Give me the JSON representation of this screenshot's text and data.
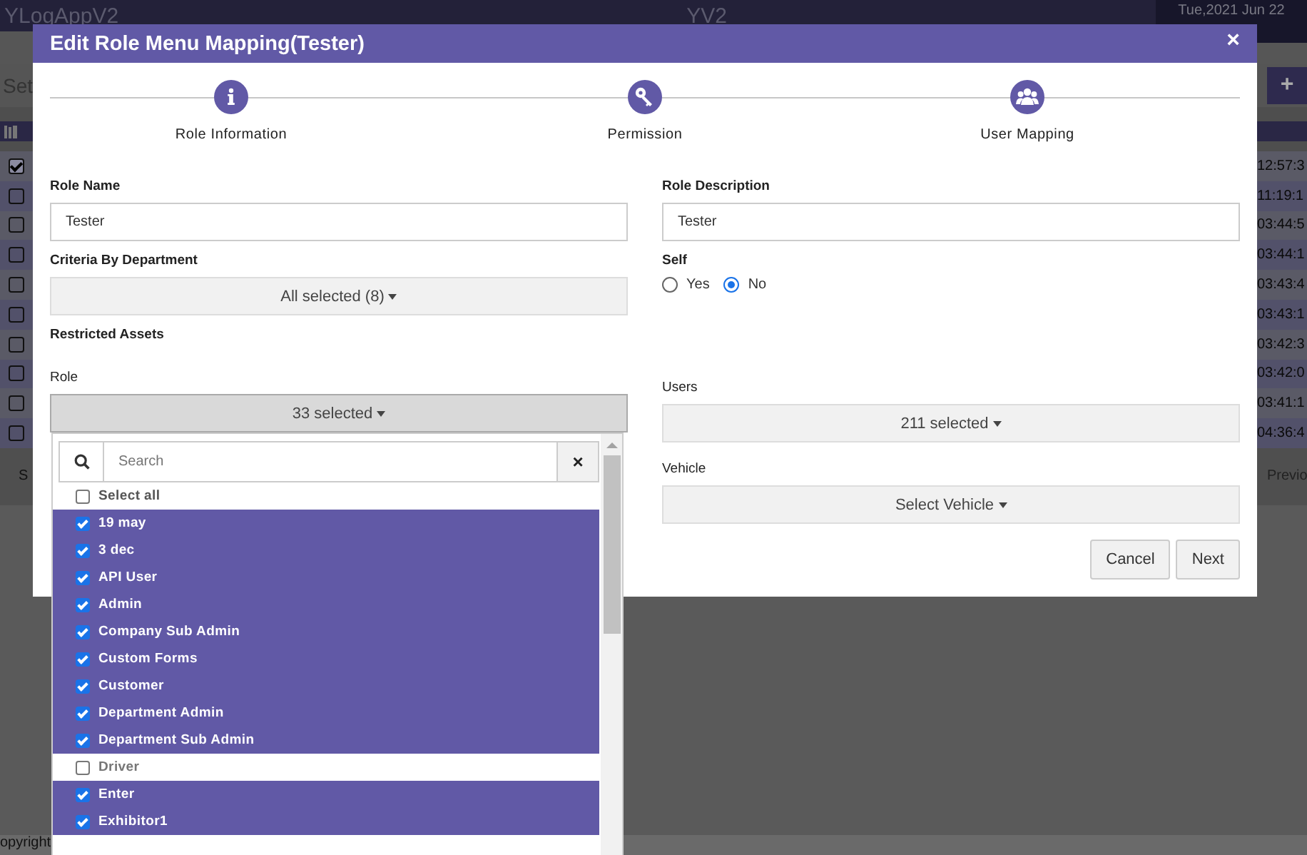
{
  "app_header": {
    "title": "YLogAppV2",
    "center_text": "YV2",
    "date": "Tue,2021 Jun 22"
  },
  "background_toolbar": {
    "text": "Set",
    "add_button": "+"
  },
  "background_rows": [
    {
      "checked": true,
      "time": "12:57:3"
    },
    {
      "checked": false,
      "time": "11:19:1"
    },
    {
      "checked": false,
      "time": "03:44:5"
    },
    {
      "checked": false,
      "time": "03:44:1"
    },
    {
      "checked": false,
      "time": "03:43:4"
    },
    {
      "checked": false,
      "time": "03:43:1"
    },
    {
      "checked": false,
      "time": "03:42:3"
    },
    {
      "checked": false,
      "time": "03:42:0"
    },
    {
      "checked": false,
      "time": "03:41:1"
    },
    {
      "checked": false,
      "time": "04:36:4"
    }
  ],
  "background_footer": {
    "left_text": "S",
    "pager": "Previo"
  },
  "copyright": "opyright",
  "modal": {
    "title": "Edit Role Menu Mapping(Tester)",
    "close": "×",
    "steps": [
      {
        "label": "Role Information",
        "kind": "info"
      },
      {
        "label": "Permission",
        "kind": "key"
      },
      {
        "label": "User Mapping",
        "kind": "users"
      }
    ],
    "role_name": {
      "label": "Role Name",
      "value": "Tester"
    },
    "role_description": {
      "label": "Role Description",
      "value": "Tester"
    },
    "criteria_by_department": {
      "label": "Criteria By Department",
      "value": "All selected (8)"
    },
    "self": {
      "label": "Self",
      "options": [
        {
          "label": "Yes",
          "selected": false
        },
        {
          "label": "No",
          "selected": true
        }
      ]
    },
    "restricted_assets": "Restricted Assets",
    "role": {
      "label": "Role",
      "value": "33 selected",
      "open": true
    },
    "users": {
      "label": "Users",
      "value": "211 selected"
    },
    "vehicle": {
      "label": "Vehicle",
      "value": "Select Vehicle"
    },
    "buttons": [
      "Cancel",
      "Next"
    ]
  },
  "role_dropdown": {
    "search_placeholder": "Search",
    "clear": "×",
    "select_all": {
      "label": "Select all",
      "checked": false
    },
    "items": [
      {
        "label": "19 may",
        "checked": true
      },
      {
        "label": "3 dec",
        "checked": true
      },
      {
        "label": "API User",
        "checked": true
      },
      {
        "label": "Admin",
        "checked": true
      },
      {
        "label": "Company Sub Admin",
        "checked": true
      },
      {
        "label": "Custom Forms",
        "checked": true
      },
      {
        "label": "Customer",
        "checked": true
      },
      {
        "label": "Department Admin",
        "checked": true
      },
      {
        "label": "Department Sub Admin",
        "checked": true
      },
      {
        "label": "Driver",
        "checked": false
      },
      {
        "label": "Enter",
        "checked": true
      },
      {
        "label": "Exhibitor1",
        "checked": true
      }
    ]
  }
}
